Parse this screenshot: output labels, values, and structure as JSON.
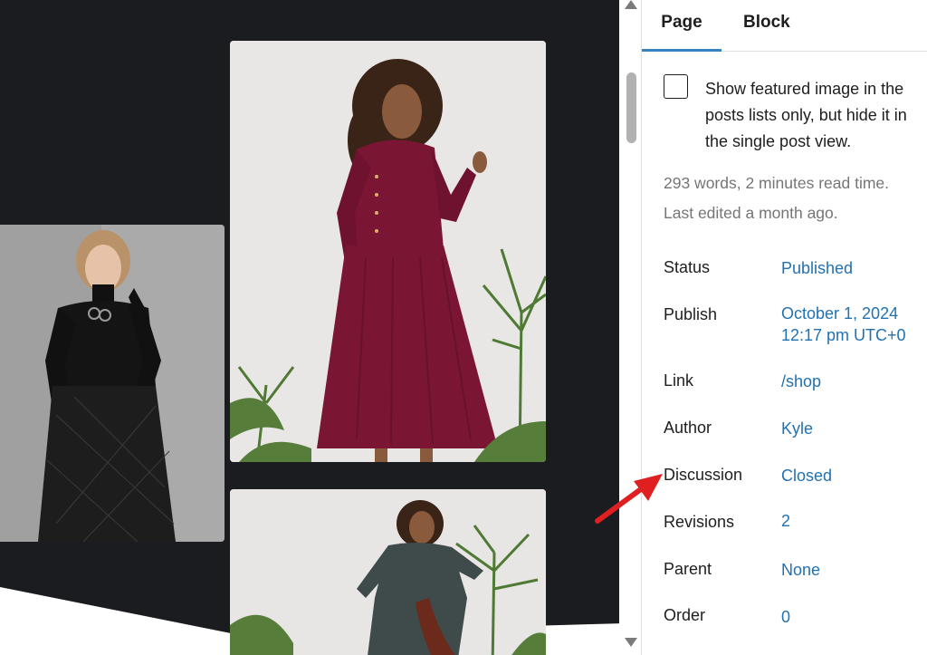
{
  "sidebar": {
    "tabs": [
      {
        "label": "Page",
        "active": true
      },
      {
        "label": "Block",
        "active": false
      }
    ],
    "featured_image": {
      "checked": false,
      "label": "Show featured image in the posts lists only, but hide it in the single post view."
    },
    "stats": {
      "words": "293 words, 2 minutes read time.",
      "edited": "Last edited a month ago."
    },
    "rows": [
      {
        "label": "Status",
        "value": "Published"
      },
      {
        "label": "Publish",
        "value": "October 1, 2024",
        "value2": "12:17 pm UTC+0"
      },
      {
        "label": "Link",
        "value": "/shop"
      },
      {
        "label": "Author",
        "value": "Kyle"
      },
      {
        "label": "Discussion",
        "value": "Closed"
      },
      {
        "label": "Revisions",
        "value": "2"
      },
      {
        "label": "Parent",
        "value": "None"
      },
      {
        "label": "Order",
        "value": "0"
      }
    ]
  },
  "colors": {
    "accent": "#2271b1",
    "tab_underline": "#3582c4",
    "canvas_dark": "#1a1c20",
    "arrow": "#e02020",
    "dress_red": "#7a1534"
  },
  "icons": {
    "scroll_up": "triangle-up-icon",
    "scroll_down": "triangle-down-icon",
    "annotation": "red-arrow-icon"
  }
}
